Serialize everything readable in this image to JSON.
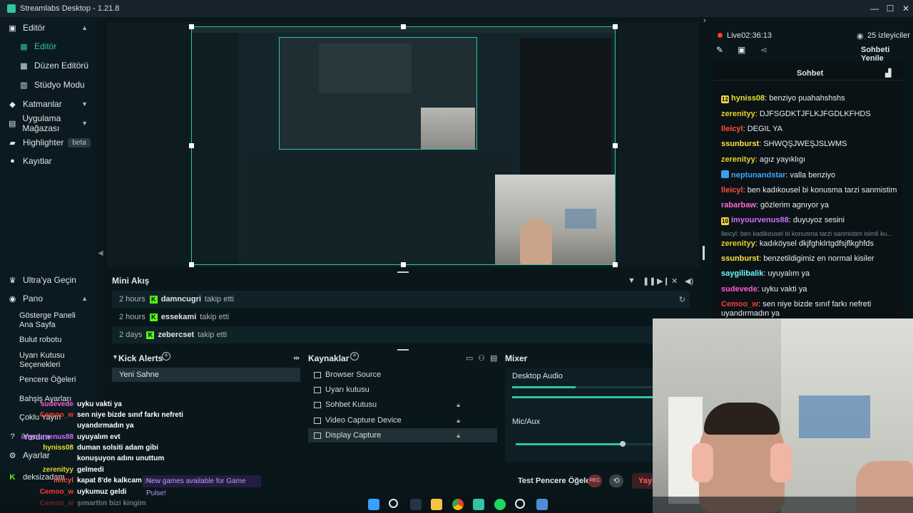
{
  "app": {
    "title": "Streamlabs Desktop - 1.21.8"
  },
  "window": {
    "minimize": "—",
    "maximize": "☐",
    "close": "✕"
  },
  "sidebar": {
    "items": [
      {
        "label": "Editör",
        "icon": "monitor-icon"
      },
      {
        "label": "Editör",
        "icon": "grid-icon"
      },
      {
        "label": "Düzen Editörü",
        "icon": "layout-icon"
      },
      {
        "label": "Stüdyo Modu",
        "icon": "studio-icon"
      },
      {
        "label": "Katmanlar",
        "icon": "layers-icon"
      },
      {
        "label": "Uygulama Mağazası",
        "icon": "store-icon"
      },
      {
        "label": "Highlighter",
        "icon": "highlighter-icon",
        "badge": "beta"
      },
      {
        "label": "Kayıtlar",
        "icon": "record-icon"
      }
    ],
    "bottom": [
      {
        "label": "Ultra'ya Geçin",
        "icon": "ultra-icon"
      },
      {
        "label": "Pano",
        "icon": "dashboard-icon"
      },
      {
        "label": "Gösterge Paneli Ana Sayfa"
      },
      {
        "label": "Bulut robotu"
      },
      {
        "label": "Uyarı Kutusu Seçenekleri"
      },
      {
        "label": "Pencere Öğeleri"
      },
      {
        "label": "Bahşiş Ayarları"
      },
      {
        "label": "Çoklu Yayın"
      },
      {
        "label": "Yardım"
      },
      {
        "label": "Ayarlar"
      },
      {
        "label": "deksizadam"
      }
    ]
  },
  "mini_feed": {
    "title": "Mini Akış",
    "rows": [
      {
        "time": "2 hours",
        "user": "damncugri",
        "action": "takip etti"
      },
      {
        "time": "2 hours",
        "user": "essekami",
        "action": "takip etti"
      },
      {
        "time": "2 days",
        "user": "zebercset",
        "action": "takip etti"
      }
    ]
  },
  "panels": {
    "alerts": {
      "title": "Kick Alerts",
      "scene": "Yeni Sahne"
    },
    "sources": {
      "title": "Kaynaklar",
      "items": [
        "Browser Source",
        "Uyarı kutusu",
        "Sohbet Kutusu",
        "Video Capture Device",
        "Display Capture"
      ]
    },
    "mixer": {
      "title": "Mixer",
      "channels": [
        {
          "name": "Desktop Audio",
          "level": 0.45
        },
        {
          "name": "Mic/Aux",
          "level": 0.78
        }
      ]
    }
  },
  "bottom_bar": {
    "test_label": "Test Pencere Öğeleri",
    "rec": "REC",
    "live": "Yayın"
  },
  "stream": {
    "status": "Live",
    "time": "02:36:13",
    "viewers": "25 izleyiciler",
    "refresh": "Sohbeti Yenile"
  },
  "chat": {
    "title": "Sohbet",
    "messages": [
      {
        "badge": "12",
        "badge_color": "#f0d340",
        "user": "hyniss08",
        "color": "#e7e12b",
        "text": "benziyo puahahshshs"
      },
      {
        "user": "zerenityy",
        "color": "#e9d025",
        "text": "DJFSGDKTJFLKJFGDLKFHDS"
      },
      {
        "user": "lleicyl",
        "color": "#ff4d3c",
        "text": "DEGIL YA"
      },
      {
        "user": "ssunburst",
        "color": "#ffe33b",
        "text": "SHWQŞJWEŞJSLWMS"
      },
      {
        "user": "zerenityy",
        "color": "#e9d025",
        "text": "agız yayıklıgı"
      },
      {
        "badge": "",
        "badge_color": "#3aa0e8",
        "user": "neptunandstar",
        "color": "#41a6ff",
        "text": "valla benziyo"
      },
      {
        "user": "lleicyl",
        "color": "#ff4d3c",
        "text": "ben kadıkousel bi konusma tarzi sanmistim"
      },
      {
        "user": "rabarbaw",
        "color": "#ff6ad5",
        "text": "gözlerim agnıyor ya"
      },
      {
        "badge": "10",
        "badge_color": "#f0d340",
        "user": "imyourvenus88",
        "color": "#cf6fff",
        "text": "duyuyoz sesini"
      },
      {
        "reply": "lleicyl: ben kadikousel bi konusma tarzi sanmistim isimli ku..."
      },
      {
        "user": "zerenityy",
        "color": "#e9d025",
        "text": "kadıköysel dkjfghklrtgdfsjflkghfds"
      },
      {
        "user": "ssunburst",
        "color": "#ffe33b",
        "text": "benzetildigimiz en normal kisiler"
      },
      {
        "user": "saygilibalik",
        "color": "#6cf5ff",
        "text": "uyuyalım ya"
      },
      {
        "user": "sudevede",
        "color": "#ff5ad0",
        "text": "uyku vakti ya"
      },
      {
        "user": "Cemoo_w",
        "color": "#ff3a2f",
        "text": "sen niye bizde sınıf farkı nefreti uyandırmadın ya"
      }
    ]
  },
  "overlay_chat": [
    {
      "user": "sudevede",
      "color": "#ff5ad0",
      "text": "uyku vakti ya"
    },
    {
      "user": "Cemoo_w",
      "color": "#ff3a2f",
      "text": "sen niye bizde sınıf farkı nefreti"
    },
    {
      "user": "",
      "color": "#ffffff",
      "text": "uyandırmadın ya"
    },
    {
      "user": "imyourvenus88",
      "color": "#cf6fff",
      "text": "uyuyalım evt"
    },
    {
      "user": "hyniss08",
      "color": "#e7e12b",
      "text": "duman solsiti adam gibi"
    },
    {
      "user": "",
      "color": "#ffffff",
      "text": "konuşuyon adını unuttum"
    },
    {
      "user": "zerenityy",
      "color": "#e9d025",
      "text": "gelmedi"
    },
    {
      "user": "lleicyl",
      "color": "#ff4d3c",
      "text": "kapat 8'de kalkcam ya"
    },
    {
      "user": "Cemoo_w",
      "color": "#ff3a2f",
      "text": "uykumuz geldi"
    },
    {
      "user": "Cemoo_w",
      "color": "#ff3a2f",
      "text": "şımarttın bizi kingim"
    }
  ],
  "notification": "New games available for Game Pulse!",
  "taskbar": {
    "icons": [
      "windows-icon",
      "search-icon",
      "steam-icon",
      "folder-icon",
      "chrome-icon",
      "streamlabs-icon",
      "spotify-icon",
      "media-icon",
      "app-icon"
    ]
  }
}
